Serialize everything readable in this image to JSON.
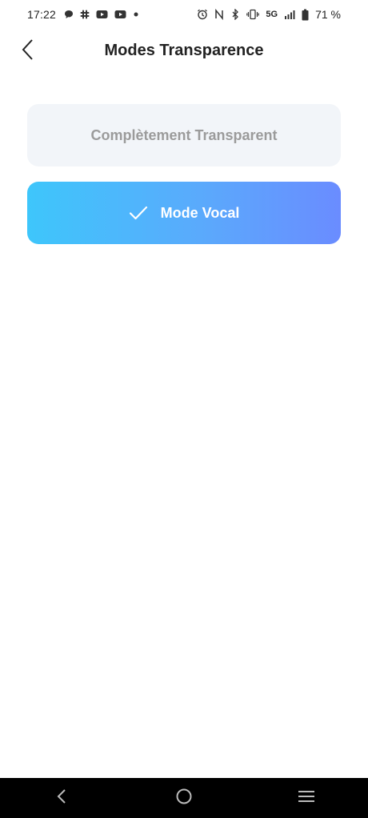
{
  "status_bar": {
    "time": "17:22",
    "battery_text": "71 %",
    "network_label": "5G",
    "left_icons": [
      "chat-bubble-icon",
      "slack-icon",
      "youtube-icon",
      "youtube-icon",
      "dot-icon"
    ],
    "right_icons": [
      "alarm-icon",
      "nfc-icon",
      "bluetooth-icon",
      "vibrate-icon",
      "signal-icon",
      "battery-icon"
    ]
  },
  "header": {
    "title": "Modes Transparence",
    "back_icon": "chevron-left-icon"
  },
  "options": [
    {
      "label": "Complètement Transparent",
      "selected": false
    },
    {
      "label": "Mode Vocal",
      "selected": true,
      "icon": "check-icon"
    }
  ],
  "colors": {
    "gradient_start": "#3ec6fb",
    "gradient_end": "#6a8cff",
    "inactive_bg": "#f2f5f9",
    "inactive_text": "#9b9b9b",
    "title_text": "#222222"
  },
  "nav_bar": {
    "icons": [
      "nav-back-icon",
      "nav-home-icon",
      "nav-recents-icon"
    ]
  }
}
